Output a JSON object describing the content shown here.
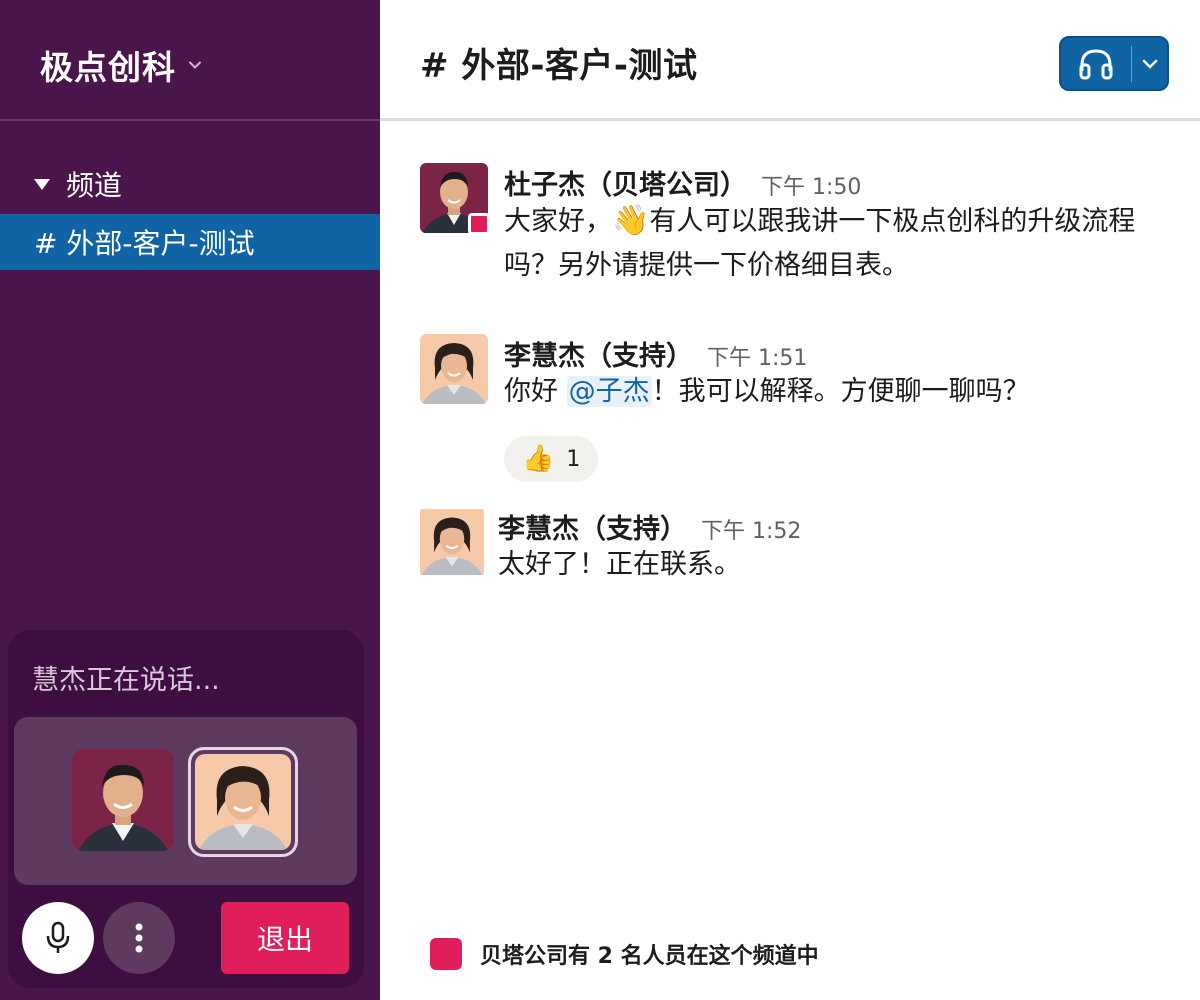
{
  "workspace": {
    "name": "极点创科"
  },
  "sidebar": {
    "section_label": "频道",
    "channels": [
      {
        "label": "# 外部-客户-测试",
        "active": true
      }
    ]
  },
  "huddle": {
    "status": "慧杰正在说话...",
    "leave_label": "退出",
    "participants": [
      "杜子杰",
      "李慧杰"
    ]
  },
  "channel": {
    "title": "# 外部-客户-测试"
  },
  "messages": [
    {
      "author": "杜子杰（贝塔公司）",
      "time": "下午 1:50",
      "text_a": "大家好，",
      "emoji": "👋",
      "text_b": "有人可以跟我讲一下极点创科的升级流程吗？另外请提供一下价格细目表。"
    },
    {
      "author": "李慧杰（支持）",
      "time": "下午 1:51",
      "text_a": "你好 ",
      "mention": "@子杰",
      "text_b": "！我可以解释。方便聊一聊吗？",
      "reaction": {
        "emoji": "👍",
        "count": "1"
      }
    },
    {
      "author": "李慧杰（支持）",
      "time": "下午 1:52",
      "text": "太好了！正在联系。"
    }
  ],
  "footer": {
    "text": "贝塔公司有 2 名人员在这个频道中"
  },
  "colors": {
    "sidebar": "#4a154b",
    "active_channel": "#1164a3",
    "accent_red": "#e01e5a",
    "huddle_panel": "#3f0e40"
  },
  "icons": [
    "chevron-down-icon",
    "caret-down-icon",
    "microphone-icon",
    "more-vertical-icon",
    "headphones-icon",
    "presence-icon"
  ]
}
